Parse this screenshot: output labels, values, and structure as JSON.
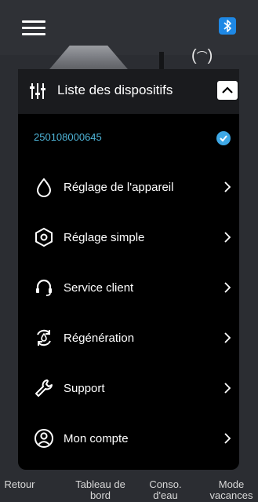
{
  "menu": {
    "title": "Liste des dispositifs",
    "device_id": "250108000645",
    "items": [
      {
        "label": "Réglage de l'appareil",
        "icon": "water-drop-icon"
      },
      {
        "label": "Réglage simple",
        "icon": "hexagon-settings-icon"
      },
      {
        "label": "Service client",
        "icon": "headset-icon"
      },
      {
        "label": "Régénération",
        "icon": "refresh-cycle-icon"
      },
      {
        "label": "Support",
        "icon": "wrench-icon"
      },
      {
        "label": "Mon compte",
        "icon": "user-circle-icon"
      }
    ]
  },
  "nav": [
    {
      "label": "Retour"
    },
    {
      "label": "Tableau de bord"
    },
    {
      "label": "Conso. d'eau"
    },
    {
      "label": "Mode vacances"
    }
  ],
  "colors": {
    "accent": "#4fb5d8",
    "check": "#3ea8e6",
    "bluetooth": "#1e88e5"
  }
}
